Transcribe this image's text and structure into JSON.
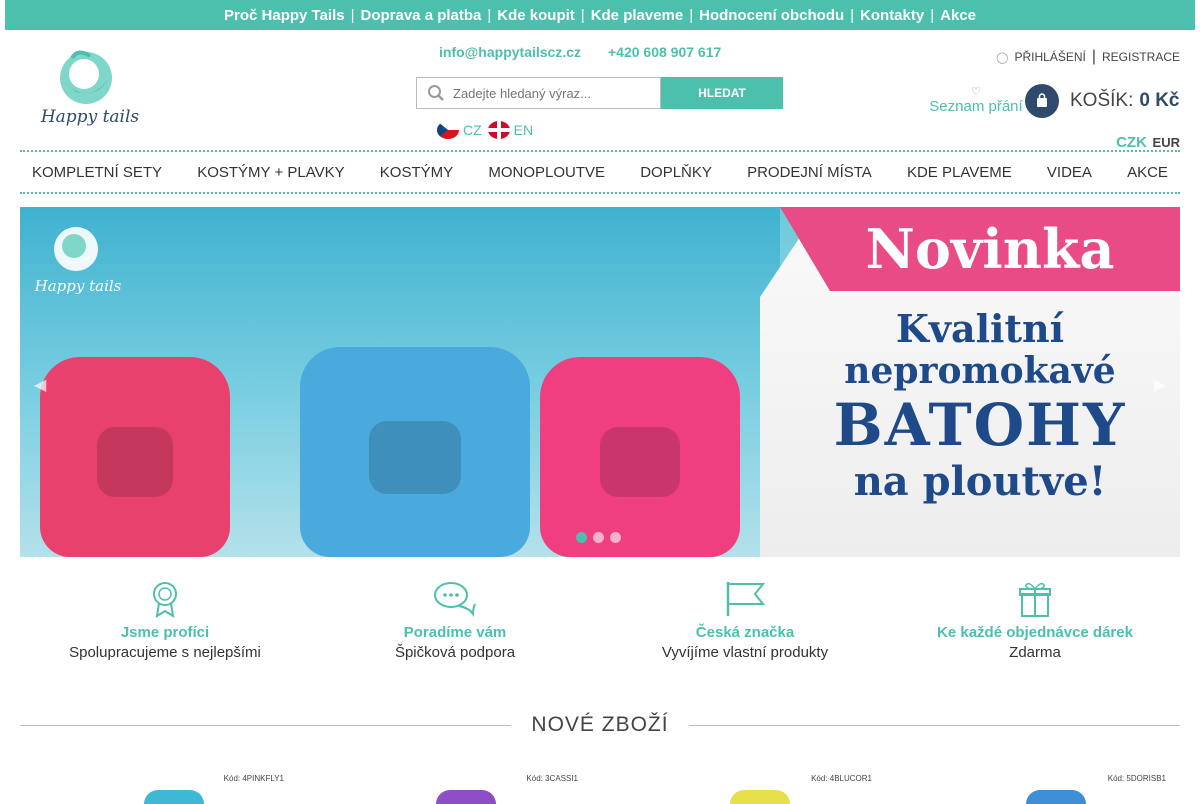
{
  "topbar": {
    "links": [
      "Proč Happy Tails",
      "Doprava a platba",
      "Kde koupit",
      "Kde plaveme",
      "Hodnocení obchodu",
      "Kontakty",
      "Akce"
    ]
  },
  "header": {
    "email": "info@happytailscz.cz",
    "phone": "+420 608 907 617",
    "search_placeholder": "Zadejte hledaný výraz...",
    "search_button": "HLEDAT",
    "lang_cz": "CZ",
    "lang_en": "EN",
    "login": "PŘIHLÁŠENÍ",
    "register": "REGISTRACE",
    "wishlist": "Seznam přání",
    "cart_label": "KOŠÍK:",
    "cart_value": "0 Kč",
    "currency_czk": "CZK",
    "currency_eur": "EUR"
  },
  "logo": {
    "text": "Happy tails"
  },
  "nav": {
    "items": [
      "KOMPLETNÍ SETY",
      "KOSTÝMY + PLAVKY",
      "KOSTÝMY",
      "MONOPLOUTVE",
      "DOPLŇKY",
      "PRODEJNÍ MÍSTA",
      "KDE PLAVEME",
      "VIDEA",
      "AKCE"
    ]
  },
  "banner": {
    "badge": "Novinka",
    "line1": "Kvalitní",
    "line2": "nepromokavé",
    "line3": "BATOHY",
    "line4": "na ploutve!",
    "logo_text": "Happy tails",
    "slides": 3,
    "active_slide": 1
  },
  "features": [
    {
      "icon": "award-icon",
      "title": "Jsme profíci",
      "subtitle": "Spolupracujeme s nejlepšími"
    },
    {
      "icon": "chat-bubbles-icon",
      "title": "Poradíme vám",
      "subtitle": "Špičková podpora"
    },
    {
      "icon": "flag-icon",
      "title": "Česká značka",
      "subtitle": "Vyvíjíme vlastní produkty"
    },
    {
      "icon": "gift-icon",
      "title": "Ke každé objednávce dárek",
      "subtitle": "Zdarma"
    }
  ],
  "new_products": {
    "title": "NOVÉ ZBOŽÍ",
    "items": [
      {
        "code": "Kód: 4PINKFLY1",
        "color": "#3fb8d6"
      },
      {
        "code": "Kód: 3CASSI1",
        "color": "#8e4fc6"
      },
      {
        "code": "Kód: 4BLUCOR1",
        "color": "#e8e04a"
      },
      {
        "code": "Kód: 5DORISB1",
        "color": "#3f8fd6"
      }
    ]
  },
  "colors": {
    "accent": "#4cbfad",
    "dark_blue": "#2f4a6a"
  }
}
